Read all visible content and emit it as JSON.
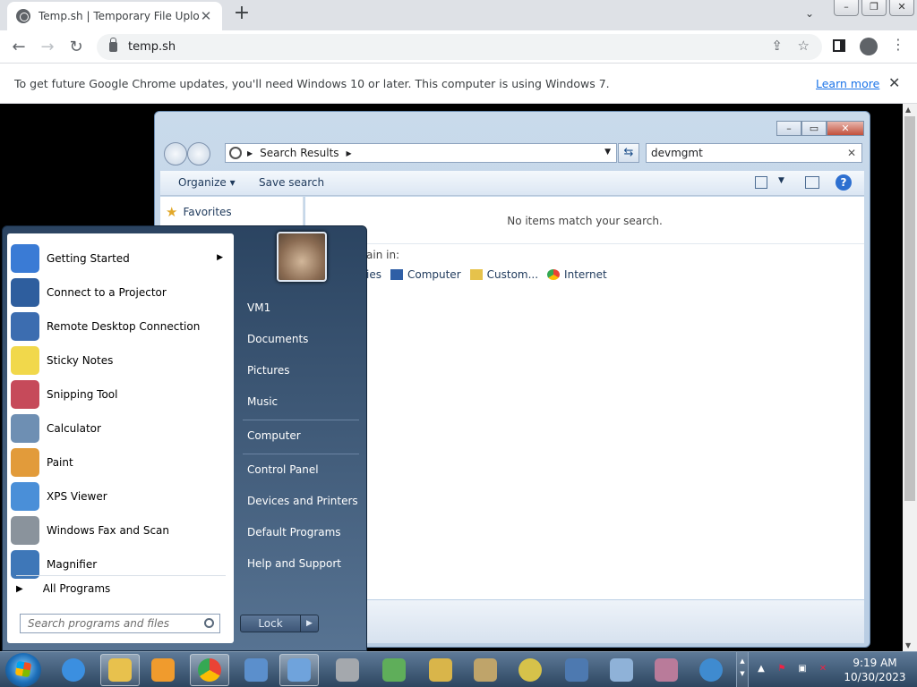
{
  "browser": {
    "tab_title": "Temp.sh | Temporary File Upload",
    "tab_close": "✕",
    "new_tab": "+",
    "url": "temp.sh",
    "info_message": "To get future Google Chrome updates, you'll need Windows 10 or later. This computer is using Windows 7.",
    "learn_more": "Learn more",
    "info_close": "✕"
  },
  "explorer": {
    "breadcrumb": "Search Results",
    "search_value": "devmgmt",
    "organize": "Organize ▾",
    "save_search": "Save search",
    "favorites": "Favorites",
    "no_items": "No items match your search.",
    "search_again_label": "ain in:",
    "search_again": [
      "ies",
      "Computer",
      "Custom...",
      "Internet"
    ]
  },
  "start_menu": {
    "programs": [
      {
        "label": "Getting Started",
        "has_submenu": true,
        "color": "#3a7bd5"
      },
      {
        "label": "Connect to a Projector",
        "color": "#2e5e9e"
      },
      {
        "label": "Remote Desktop Connection",
        "color": "#3c6db0"
      },
      {
        "label": "Sticky Notes",
        "color": "#f1d84b"
      },
      {
        "label": "Snipping Tool",
        "color": "#c64a5a"
      },
      {
        "label": "Calculator",
        "color": "#6e8fb3"
      },
      {
        "label": "Paint",
        "color": "#e29b3a"
      },
      {
        "label": "XPS Viewer",
        "color": "#4a8fd8"
      },
      {
        "label": "Windows Fax and Scan",
        "color": "#8a939c"
      },
      {
        "label": "Magnifier",
        "color": "#3e77b8"
      }
    ],
    "all_programs": "All Programs",
    "search_placeholder": "Search programs and files",
    "right_items": [
      "VM1",
      "Documents",
      "Pictures",
      "Music",
      "Computer",
      "Control Panel",
      "Devices and Printers",
      "Default Programs",
      "Help and Support"
    ],
    "lock_label": "Lock"
  },
  "taskbar": {
    "time": "9:19 AM",
    "date": "10/30/2023",
    "apps": [
      "internet-explorer",
      "windows-explorer",
      "media-player",
      "chrome",
      "remote-desktop",
      "control-panel",
      "firewall",
      "network-tool",
      "security-tool",
      "drive-tool",
      "help-tool",
      "network-monitor",
      "event-viewer",
      "services",
      "globe-security"
    ]
  }
}
